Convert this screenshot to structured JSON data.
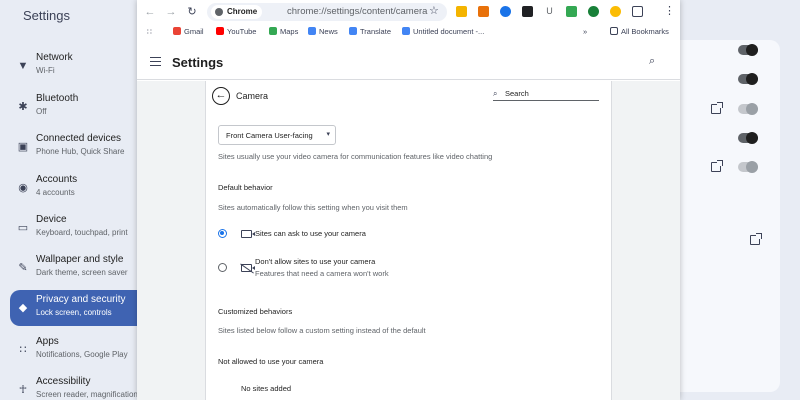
{
  "os": {
    "title": "Settings",
    "sidebar": [
      {
        "label": "Network",
        "sub": "Wi-Fi",
        "icon": "wifi-icon",
        "active": false
      },
      {
        "label": "Bluetooth",
        "sub": "Off",
        "icon": "bluetooth-icon",
        "active": false
      },
      {
        "label": "Connected devices",
        "sub": "Phone Hub, Quick Share",
        "icon": "devices-icon",
        "active": false
      },
      {
        "label": "Accounts",
        "sub": "4 accounts",
        "icon": "account-icon",
        "active": false
      },
      {
        "label": "Device",
        "sub": "Keyboard, touchpad, print",
        "icon": "laptop-icon",
        "active": false
      },
      {
        "label": "Wallpaper and style",
        "sub": "Dark theme, screen saver",
        "icon": "palette-icon",
        "active": false
      },
      {
        "label": "Privacy and security",
        "sub": "Lock screen, controls",
        "icon": "shield-icon",
        "active": true
      },
      {
        "label": "Apps",
        "sub": "Notifications, Google Play",
        "icon": "apps-grid-icon",
        "active": false
      },
      {
        "label": "Accessibility",
        "sub": "Screen reader, magnification",
        "icon": "accessibility-icon",
        "active": false
      }
    ]
  },
  "browser": {
    "chip_label": "Chrome",
    "url": "chrome://settings/content/camera",
    "bookmarks": [
      "Gmail",
      "YouTube",
      "Maps",
      "News",
      "Translate",
      "Untitled document -..."
    ],
    "all_bookmarks": "All Bookmarks"
  },
  "settings": {
    "title": "Settings",
    "page_title": "Camera",
    "search_placeholder": "Search",
    "device_select": "Front Camera User-facing",
    "device_desc": "Sites usually use your video camera for communication features like video chatting",
    "default_heading": "Default behavior",
    "default_desc": "Sites automatically follow this setting when you visit them",
    "option_allow": "Sites can ask to use your camera",
    "option_block": "Don't allow sites to use your camera",
    "option_block_sub": "Features that need a camera won't work",
    "custom_heading": "Customized behaviors",
    "custom_desc": "Sites listed below follow a custom setting instead of the default",
    "not_allowed_heading": "Not allowed to use your camera",
    "no_sites": "No sites added"
  }
}
